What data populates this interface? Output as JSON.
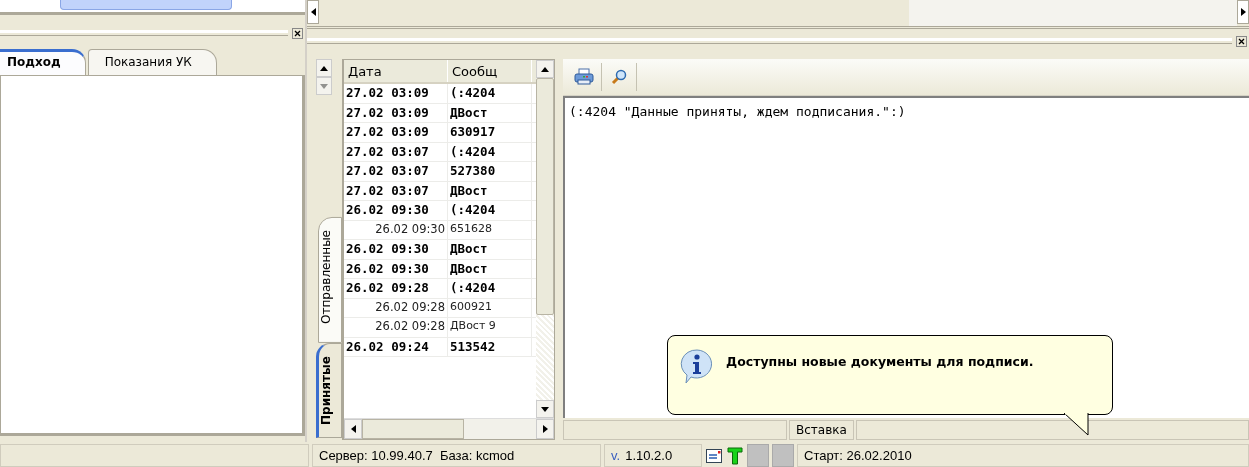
{
  "left_panel": {
    "tabs": [
      {
        "label": "Подход",
        "selected": true
      },
      {
        "label": "Показания УК",
        "selected": false
      }
    ]
  },
  "side_tabs": [
    {
      "label": "Отправленные",
      "selected": false
    },
    {
      "label": "Принятые",
      "selected": true
    }
  ],
  "messages": {
    "columns": [
      "Дата",
      "Сообщ"
    ],
    "rows": [
      {
        "date": "27.02 03:09",
        "message": "(:4204",
        "unread": true
      },
      {
        "date": "27.02 03:09",
        "message": "ДВост",
        "unread": true
      },
      {
        "date": "27.02 03:09",
        "message": "630917",
        "unread": true
      },
      {
        "date": "27.02 03:07",
        "message": "(:4204",
        "unread": true
      },
      {
        "date": "27.02 03:07",
        "message": "527380",
        "unread": true
      },
      {
        "date": "27.02 03:07",
        "message": "ДВост",
        "unread": true
      },
      {
        "date": "26.02 09:30",
        "message": "(:4204",
        "unread": true
      },
      {
        "date": "26.02 09:30",
        "message": "651628",
        "unread": false
      },
      {
        "date": "26.02 09:30",
        "message": "ДВост",
        "unread": true
      },
      {
        "date": "26.02 09:30",
        "message": "ДВост",
        "unread": true
      },
      {
        "date": "26.02 09:28",
        "message": "(:4204",
        "unread": true
      },
      {
        "date": "26.02 09:28",
        "message": "600921",
        "unread": false
      },
      {
        "date": "26.02 09:28",
        "message": "ДВост 9",
        "unread": false
      },
      {
        "date": "26.02 09:24",
        "message": "513542",
        "unread": true
      }
    ]
  },
  "viewer": {
    "text": "(:4204 \"Данные приняты, ждем подписания.\":)"
  },
  "editor_status": {
    "mode": "Вставка"
  },
  "notification": {
    "text": "Доступны новые документы для подписи."
  },
  "status_bar": {
    "server": "Сервер: 10.99.40.7  База: kcmod",
    "version_prefix": "v.",
    "version": "1.10.2.0",
    "start": "Старт: 26.02.2010"
  }
}
